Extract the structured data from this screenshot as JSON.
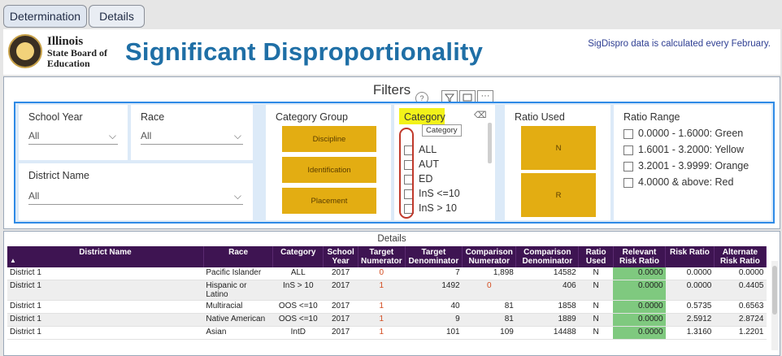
{
  "tabs": [
    {
      "label": "Determination"
    },
    {
      "label": "Details"
    }
  ],
  "header": {
    "logo_text": [
      "Illinois",
      "State Board of",
      "Education"
    ],
    "title": "Significant Disproportionality",
    "note": "SigDispro data is calculated every February."
  },
  "filters": {
    "title": "Filters",
    "school_year": {
      "label": "School Year",
      "value": "All"
    },
    "race": {
      "label": "Race",
      "value": "All"
    },
    "district_name": {
      "label": "District Name",
      "value": "All"
    },
    "category_group": {
      "label": "Category Group",
      "options": [
        "Discipline",
        "Identification",
        "Placement"
      ]
    },
    "category": {
      "label": "Category",
      "tooltip": "Category",
      "items": [
        "ALL",
        "AUT",
        "ED",
        "InS <=10",
        "InS > 10"
      ]
    },
    "ratio_used": {
      "label": "Ratio Used",
      "options": [
        "N",
        "R"
      ]
    },
    "ratio_range": {
      "label": "Ratio Range",
      "items": [
        "0.0000 - 1.6000: Green",
        "1.6001 - 3.2000: Yellow",
        "3.2001 - 3.9999: Orange",
        "4.0000 & above: Red"
      ]
    }
  },
  "details": {
    "title": "Details",
    "columns": [
      "District Name",
      "Race",
      "Category",
      "School Year",
      "Target Numerator",
      "Target Denominator",
      "Comparison Numerator",
      "Comparison Denominator",
      "Ratio Used",
      "Relevant Risk Ratio",
      "Risk Ratio",
      "Alternate Risk Ratio"
    ],
    "rows": [
      [
        "District 1",
        "Pacific Islander",
        "ALL",
        "2017",
        "0",
        "7",
        "1,898",
        "14582",
        "N",
        "0.0000",
        "0.0000",
        "0.0000"
      ],
      [
        "District 1",
        "Hispanic or Latino",
        "InS > 10",
        "2017",
        "1",
        "1492",
        "0",
        "406",
        "N",
        "0.0000",
        "0.0000",
        "0.4405"
      ],
      [
        "District 1",
        "Multiracial",
        "OOS <=10",
        "2017",
        "1",
        "40",
        "81",
        "1858",
        "N",
        "0.0000",
        "0.5735",
        "0.6563"
      ],
      [
        "District 1",
        "Native American",
        "OOS <=10",
        "2017",
        "1",
        "9",
        "81",
        "1889",
        "N",
        "0.0000",
        "2.5912",
        "2.8724"
      ],
      [
        "District 1",
        "Asian",
        "IntD",
        "2017",
        "1",
        "101",
        "109",
        "14488",
        "N",
        "0.0000",
        "1.3160",
        "1.2201"
      ]
    ]
  },
  "colors": {
    "accent": "#1f6fa6",
    "gold": "#e3ad12",
    "header_purple": "#3e1452",
    "green_cell": "#7fc97f",
    "highlight_yellow": "#f2f21a"
  }
}
